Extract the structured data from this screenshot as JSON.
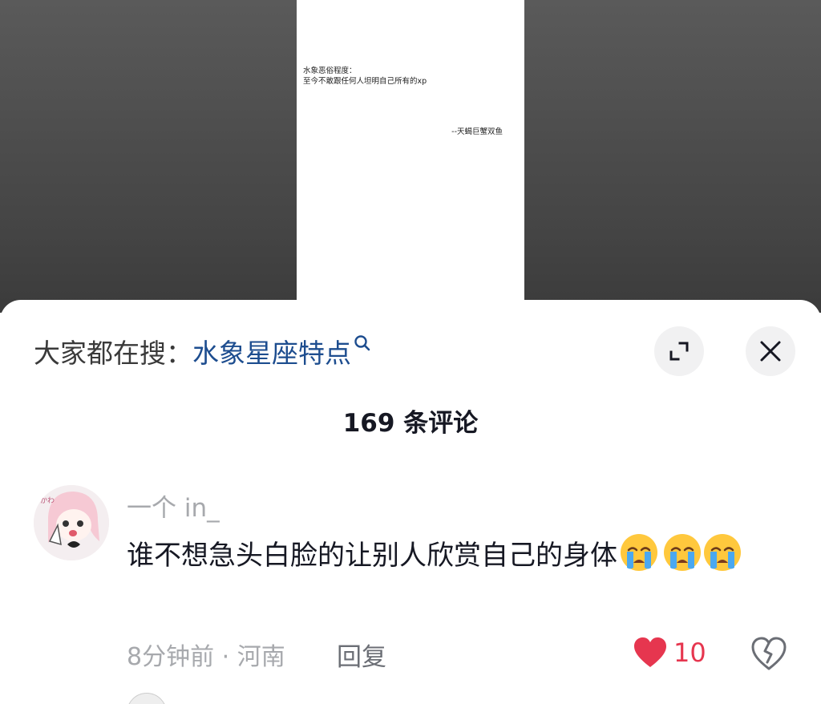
{
  "post": {
    "line1": "水象恶俗程度：",
    "line2": "至今不敢跟任何人坦明自己所有的xp",
    "signature": "--天蝎巨蟹双鱼"
  },
  "search": {
    "prefix": "大家都在搜：",
    "term": "水象星座特点"
  },
  "comments_header": {
    "count_label": "169 条评论"
  },
  "comment": {
    "username": "一个 in_",
    "text": "谁不想急头白脸的让别人欣赏自己的身体",
    "emoji": "crying-face-icon",
    "emoji_count": 3,
    "time_location": "8分钟前 · 河南",
    "reply_label": "回复",
    "like_count": "10"
  },
  "colors": {
    "search_term": "#1d4d8f",
    "like_red": "#e6364f",
    "muted_text": "#a7a9ad",
    "button_bg": "#f1f1f2"
  },
  "icons": [
    "search-icon",
    "expand-icon",
    "close-icon",
    "heart-icon",
    "broken-heart-icon",
    "crying-face-icon"
  ]
}
